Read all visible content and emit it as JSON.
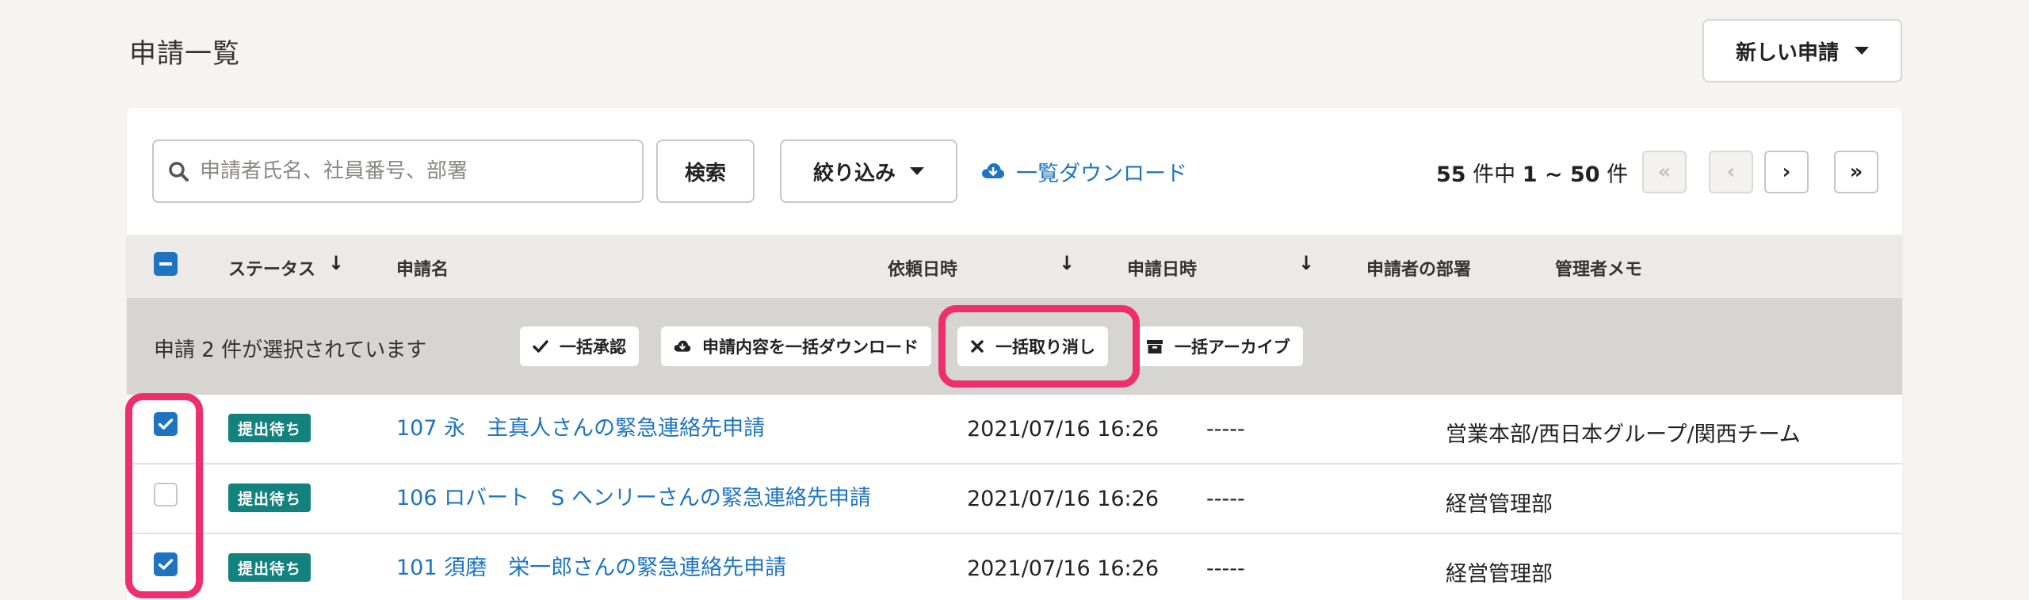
{
  "page": {
    "title": "申請一覧"
  },
  "header": {
    "new_request_label": "新しい申請"
  },
  "toolbar": {
    "search_placeholder": "申請者氏名、社員番号、部署",
    "search_value": "",
    "search_button": "検索",
    "filter_button": "絞り込み",
    "download_link": "一覧ダウンロード"
  },
  "pagination": {
    "total": "55",
    "unit_total": "件中",
    "range": "1 ~ 50",
    "unit_range": "件",
    "first": "«",
    "prev": "‹",
    "next": "›",
    "last": "»"
  },
  "table": {
    "columns": [
      "ステータス",
      "申請名",
      "依頼日時",
      "申請日時",
      "申請者の部署",
      "管理者メモ"
    ]
  },
  "bulk": {
    "selected_text": "申請 2 件が選択されています",
    "actions": [
      "一括承認",
      "申請内容を一括ダウンロード",
      "一括取り消し",
      "一括アーカイブ"
    ]
  },
  "rows": [
    {
      "checked": true,
      "status": "提出待ち",
      "name": "107 永　主真人さんの緊急連絡先申請",
      "requested_at": "2021/07/16 16:26",
      "submitted_at": "-----",
      "department": "営業本部/西日本グループ/関西チーム",
      "memo": ""
    },
    {
      "checked": false,
      "status": "提出待ち",
      "name": "106 ロバート　S ヘンリーさんの緊急連絡先申請",
      "requested_at": "2021/07/16 16:26",
      "submitted_at": "-----",
      "department": "経営管理部",
      "memo": ""
    },
    {
      "checked": true,
      "status": "提出待ち",
      "name": "101 須磨　栄一郎さんの緊急連絡先申請",
      "requested_at": "2021/07/16 16:26",
      "submitted_at": "-----",
      "department": "経営管理部",
      "memo": ""
    }
  ],
  "colors": {
    "accent": "#1f74c2",
    "status_badge": "#13827f",
    "highlight": "#ee2f6e"
  }
}
